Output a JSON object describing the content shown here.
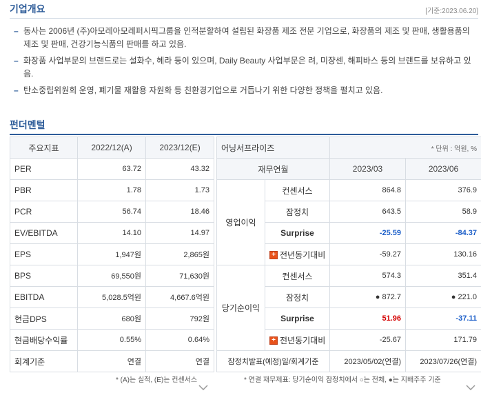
{
  "overview": {
    "title": "기업개요",
    "date": "[기준:2023.06.20]",
    "items": [
      "동사는 2006년 (주)아모레아모레퍼시픽그룹을 인적분할하여 설립된 화장품 제조 전문 기업으로, 화장품의 제조 및 판매, 생활용품의 제조 및 판매, 건강기능식품의 판매를 하고 있음.",
      "화장품 사업부문의 브랜드로는 설화수, 헤라 등이 있으며, Daily Beauty 사업부문은 려, 미쟝센, 해피바스 등의 브랜드를 보유하고 있음.",
      "탄소중립위원회 운영, 폐기물 재활용 자원화 등 친환경기업으로 거듭나기 위한 다양한 정책을 펼치고 있음."
    ]
  },
  "fundamentals": {
    "title": "펀더멘털",
    "headers": [
      "주요지표",
      "2022/12(A)",
      "2023/12(E)"
    ],
    "rows": [
      {
        "label": "PER",
        "a": "63.72",
        "e": "43.32"
      },
      {
        "label": "PBR",
        "a": "1.78",
        "e": "1.73"
      },
      {
        "label": "PCR",
        "a": "56.74",
        "e": "18.46"
      },
      {
        "label": "EV/EBITDA",
        "a": "14.10",
        "e": "14.97"
      },
      {
        "label": "EPS",
        "a": "1,947원",
        "e": "2,865원"
      },
      {
        "label": "BPS",
        "a": "69,550원",
        "e": "71,630원"
      },
      {
        "label": "EBITDA",
        "a": "5,028.5억원",
        "e": "4,667.6억원"
      },
      {
        "label": "현금DPS",
        "a": "680원",
        "e": "792원"
      },
      {
        "label": "현금배당수익률",
        "a": "0.55%",
        "e": "0.64%"
      },
      {
        "label": "회계기준",
        "a": "연결",
        "e": "연결"
      }
    ],
    "note": "* (A)는 실적, (E)는 컨센서스"
  },
  "earnings": {
    "title": "어닝서프라이즈",
    "unit": "* 단위 : 억원, %",
    "header_label": "재무연월",
    "periods": [
      "2023/03",
      "2023/06"
    ],
    "op_group": "영업이익",
    "net_group": "당기순이익",
    "op_rows": [
      {
        "label": "컨센서스",
        "v1": "864.8",
        "v2": "376.9"
      },
      {
        "label": "잠정치",
        "v1": "643.5",
        "v2": "58.9"
      },
      {
        "label": "Surprise",
        "v1": "-25.59",
        "v2": "-84.37"
      },
      {
        "label": "전년동기대비",
        "v1": "-59.27",
        "v2": "130.16"
      }
    ],
    "net_rows": [
      {
        "label": "컨센서스",
        "v1": "574.3",
        "v2": "351.4"
      },
      {
        "label": "잠정치",
        "v1": "● 872.7",
        "v2": "● 221.0"
      },
      {
        "label": "Surprise",
        "v1": "51.96",
        "v2": "-37.11"
      },
      {
        "label": "전년동기대비",
        "v1": "-25.67",
        "v2": "171.79"
      }
    ],
    "footer_label": "잠정치발표(예정)일/회계기준",
    "footer_v1": "2023/05/02(연결)",
    "footer_v2": "2023/07/26(연결)",
    "note": "* 연결 재무제표: 당기순이익 잠정치에서 ○는 전체, ●는 지배주주 기준",
    "plus_glyph": "+",
    "chevron_icon": "chevron-down-icon"
  }
}
